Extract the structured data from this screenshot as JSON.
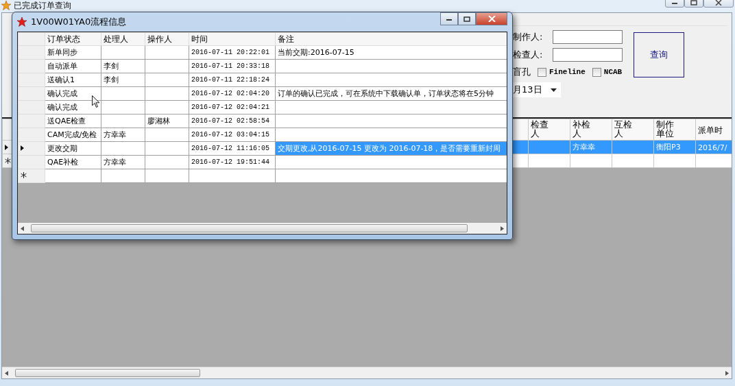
{
  "main_window": {
    "title": "已完成订单查询",
    "filters": {
      "fields": [
        {
          "label": "制作人:"
        },
        {
          "label": "检查人:"
        }
      ],
      "blind_hole_label": "盲孔",
      "checkboxes": [
        {
          "label": "Fineline",
          "checked": false
        },
        {
          "label": "NCAB",
          "checked": false
        }
      ],
      "date": "月13日",
      "query_button": "查询"
    },
    "table": {
      "columns": [
        "检查人",
        "补检人",
        "互检人",
        "制作单位",
        "派单时"
      ],
      "rows": [
        {
          "selected": true,
          "current": true,
          "cells": [
            null,
            "方幸幸",
            null,
            "衡阳P3",
            "2016/7/"
          ]
        }
      ]
    }
  },
  "dialog": {
    "title": "1V00W01YA0流程信息",
    "columns": [
      "订单状态",
      "处理人",
      "操作人",
      "时间",
      "备注"
    ],
    "rows": [
      {
        "status": "新单同步",
        "handler": null,
        "operator": null,
        "time": "2016-07-11 20:22:01",
        "note": "当前交期:2016-07-15",
        "current": false,
        "selected": false
      },
      {
        "status": "自动派单",
        "handler": "李剑",
        "operator": null,
        "time": "2016-07-11 20:33:18",
        "note": null,
        "current": false,
        "selected": false
      },
      {
        "status": "送确认1",
        "handler": "李剑",
        "operator": null,
        "time": "2016-07-11 22:18:24",
        "note": null,
        "current": false,
        "selected": false
      },
      {
        "status": "确认完成",
        "handler": null,
        "operator": null,
        "time": "2016-07-12 02:04:20",
        "note": "订单的确认已完成，可在系统中下载确认单，订单状态将在5分钟",
        "current": false,
        "selected": false
      },
      {
        "status": "确认完成",
        "handler": null,
        "operator": null,
        "time": "2016-07-12 02:04:21",
        "note": null,
        "current": false,
        "selected": false
      },
      {
        "status": "送QAE检查",
        "handler": null,
        "operator": "廖湘林",
        "time": "2016-07-12 02:58:54",
        "note": null,
        "current": false,
        "selected": false
      },
      {
        "status": "CAM完成/免检",
        "handler": "方幸幸",
        "operator": null,
        "time": "2016-07-12 03:04:15",
        "note": null,
        "current": false,
        "selected": false
      },
      {
        "status": "更改交期",
        "handler": null,
        "operator": null,
        "time": "2016-07-12 11:16:05",
        "note": "交期更改,从2016-07-15 更改为 2016-07-18，是否需要重新封周",
        "current": true,
        "selected": true
      },
      {
        "status": "QAE补检",
        "handler": "方幸幸",
        "operator": null,
        "time": "2016-07-12 19:51:44",
        "note": null,
        "current": false,
        "selected": false
      }
    ]
  }
}
